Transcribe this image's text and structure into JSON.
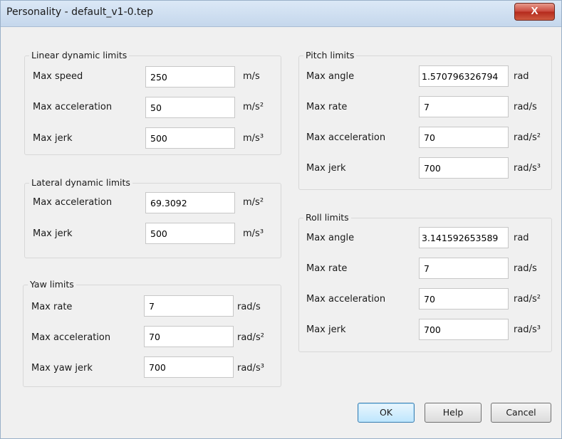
{
  "window": {
    "title": "Personality - default_v1-0.tep",
    "close_symbol": "X"
  },
  "linear": {
    "title": "Linear dynamic limits",
    "max_speed": {
      "label": "Max speed",
      "value": "250",
      "unit": "m/s"
    },
    "max_acceleration": {
      "label": "Max acceleration",
      "value": "50",
      "unit": "m/s²"
    },
    "max_jerk": {
      "label": "Max jerk",
      "value": "500",
      "unit": "m/s³"
    }
  },
  "lateral": {
    "title": "Lateral dynamic limits",
    "max_acceleration": {
      "label": "Max acceleration",
      "value": "69.3092",
      "unit": "m/s²"
    },
    "max_jerk": {
      "label": "Max jerk",
      "value": "500",
      "unit": "m/s³"
    }
  },
  "yaw": {
    "title": "Yaw limits",
    "max_rate": {
      "label": "Max rate",
      "value": "7",
      "unit": "rad/s"
    },
    "max_acceleration": {
      "label": "Max acceleration",
      "value": "70",
      "unit": "rad/s²"
    },
    "max_yaw_jerk": {
      "label": "Max yaw jerk",
      "value": "700",
      "unit": "rad/s³"
    }
  },
  "pitch": {
    "title": "Pitch limits",
    "max_angle": {
      "label": "Max angle",
      "value": "1.570796326794",
      "unit": "rad"
    },
    "max_rate": {
      "label": "Max rate",
      "value": "7",
      "unit": "rad/s"
    },
    "max_acceleration": {
      "label": "Max acceleration",
      "value": "70",
      "unit": "rad/s²"
    },
    "max_jerk": {
      "label": "Max jerk",
      "value": "700",
      "unit": "rad/s³"
    }
  },
  "roll": {
    "title": "Roll limits",
    "max_angle": {
      "label": "Max angle",
      "value": "3.141592653589",
      "unit": "rad"
    },
    "max_rate": {
      "label": "Max rate",
      "value": "7",
      "unit": "rad/s"
    },
    "max_acceleration": {
      "label": "Max acceleration",
      "value": "70",
      "unit": "rad/s²"
    },
    "max_jerk": {
      "label": "Max jerk",
      "value": "700",
      "unit": "rad/s³"
    }
  },
  "buttons": {
    "ok": "OK",
    "help": "Help",
    "cancel": "Cancel"
  }
}
